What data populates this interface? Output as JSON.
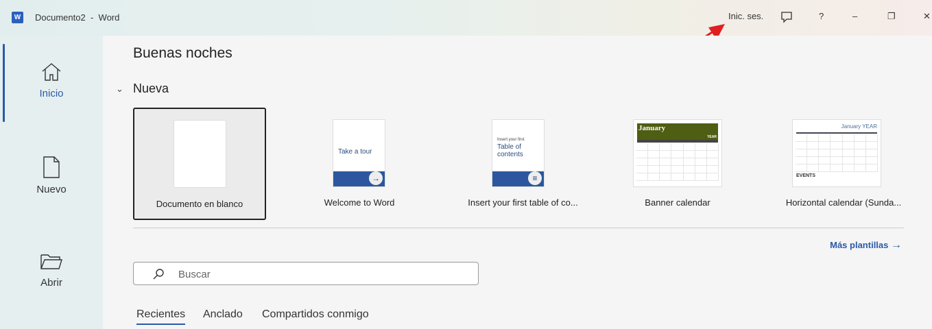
{
  "titlebar": {
    "doc_title": "Documento2",
    "sep": "-",
    "app": "Word",
    "sign_in": "Inic. ses.",
    "help": "?",
    "minimize": "–",
    "restore": "❐",
    "close": "✕"
  },
  "sidebar": {
    "items": [
      {
        "label": "Inicio"
      },
      {
        "label": "Nuevo"
      },
      {
        "label": "Abrir"
      }
    ]
  },
  "main": {
    "greeting": "Buenas noches",
    "section": "Nueva",
    "templates": [
      {
        "name": "Documento en blanco"
      },
      {
        "name": "Welcome to Word",
        "thumb_text": "Take a tour"
      },
      {
        "name": "Insert your first table of co...",
        "thumb_small": "Insert your first",
        "thumb_big": "Table of contents"
      },
      {
        "name": "Banner calendar",
        "thumb_month": "January",
        "thumb_year": "YEAR"
      },
      {
        "name": "Horizontal calendar (Sunda...",
        "thumb_title": "January YEAR",
        "thumb_events": "EVENTS"
      }
    ],
    "more_templates": "Más plantillas",
    "search_placeholder": "Buscar",
    "tabs": [
      {
        "label": "Recientes"
      },
      {
        "label": "Anclado"
      },
      {
        "label": "Compartidos conmigo"
      }
    ]
  },
  "colors": {
    "accent": "#2a5aa8",
    "annotation": "#e02020",
    "banner": "#4e5e12"
  }
}
